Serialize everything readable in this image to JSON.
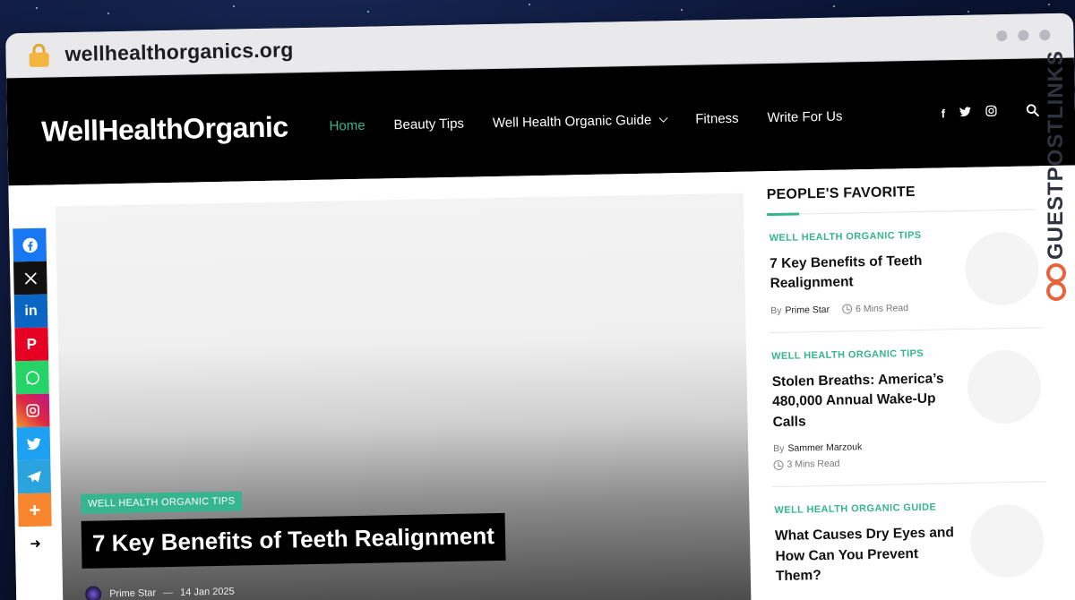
{
  "browser": {
    "url": "wellhealthorganics.org"
  },
  "header": {
    "logo": "WellHealthOrganic",
    "nav": [
      {
        "label": "Home",
        "active": true
      },
      {
        "label": "Beauty Tips"
      },
      {
        "label": "Well Health Organic Guide",
        "has_dropdown": true
      },
      {
        "label": "Fitness"
      },
      {
        "label": "Write For Us"
      }
    ],
    "social_icons": [
      "facebook-icon",
      "twitter-icon",
      "instagram-icon"
    ],
    "search_icon": "search-icon"
  },
  "share_bar": [
    {
      "name": "facebook-share",
      "glyph": "f",
      "color": "#1877f2"
    },
    {
      "name": "x-share",
      "glyph": "X",
      "color": "#111111"
    },
    {
      "name": "linkedin-share",
      "glyph": "in",
      "color": "#0a66c2"
    },
    {
      "name": "pinterest-share",
      "glyph": "P",
      "color": "#e60023"
    },
    {
      "name": "whatsapp-share",
      "glyph": "✆",
      "color": "#25d366"
    },
    {
      "name": "instagram-share",
      "glyph": "◎",
      "color": "#d6249f"
    },
    {
      "name": "twitter-share",
      "glyph": "t",
      "color": "#1da1f2"
    },
    {
      "name": "telegram-share",
      "glyph": "➤",
      "color": "#2aa3df"
    },
    {
      "name": "more-share",
      "glyph": "+",
      "color": "#f7862e"
    }
  ],
  "hero": {
    "category": "WELL HEALTH ORGANIC TIPS",
    "title": "7 Key Benefits of Teeth Realignment",
    "author": "Prime Star",
    "separator": "—",
    "date": "14 Jan 2025"
  },
  "sidebar": {
    "heading": "PEOPLE'S FAVORITE",
    "by_label": "By",
    "items": [
      {
        "category": "WELL HEALTH ORGANIC TIPS",
        "title": "7 Key Benefits of Teeth Realignment",
        "author": "Prime Star",
        "read_time": "6 Mins Read"
      },
      {
        "category": "WELL HEALTH ORGANIC TIPS",
        "title": "Stolen Breaths: America’s 480,000 Annual Wake-Up Calls",
        "author": "Sammer Marzouk",
        "read_time": "3 Mins Read"
      },
      {
        "category": "WELL HEALTH ORGANIC GUIDE",
        "title": "What Causes Dry Eyes and How Can You Prevent Them?"
      }
    ]
  },
  "watermark": "GUESTPOSTLINKS",
  "colors": {
    "accent": "#36b58e",
    "header_bg": "#000000"
  }
}
